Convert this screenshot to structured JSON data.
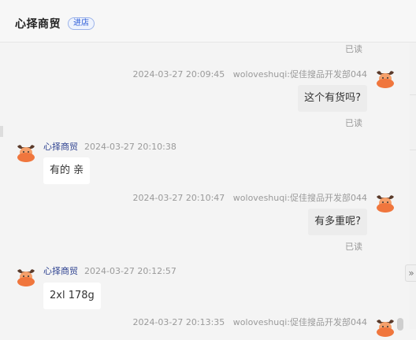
{
  "header": {
    "shop_name": "心择商贸",
    "enter_label": "进店"
  },
  "read_label": "已读",
  "messages": [
    {
      "time": "2024-03-27 20:09:45",
      "sender": "woloveshuqi:促佳搜品开发部044",
      "text": "这个有货吗?",
      "read": "已读"
    },
    {
      "time": "2024-03-27 20:10:38",
      "sender": "心择商贸",
      "text": "有的 亲"
    },
    {
      "time": "2024-03-27 20:10:47",
      "sender": "woloveshuqi:促佳搜品开发部044",
      "text": "有多重呢?",
      "read": "已读"
    },
    {
      "time": "2024-03-27 20:12:57",
      "sender": "心择商贸",
      "text": "2xl 178g"
    },
    {
      "time": "2024-03-27 20:13:35",
      "sender": "woloveshuqi:促佳搜品开发部044"
    }
  ],
  "icons": {
    "avatar": "bull-avatar-icon",
    "expand": "double-chevron-right-icon"
  },
  "colors": {
    "accent": "#2a5bd7",
    "name_link": "#2b3f8f",
    "avatar_orange": "#f0763d"
  }
}
